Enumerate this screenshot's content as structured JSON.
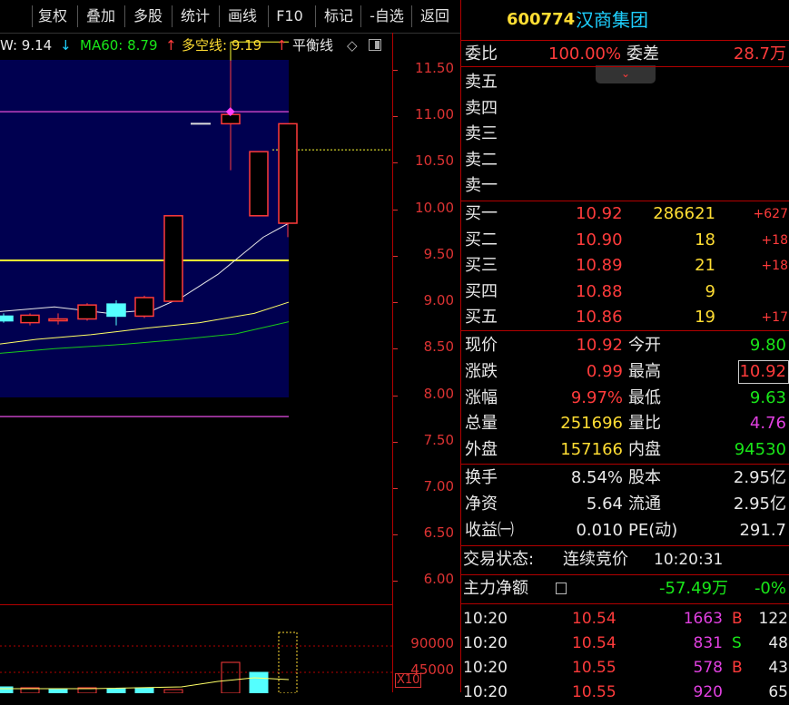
{
  "toolbar": {
    "items": [
      "复权",
      "叠加",
      "多股",
      "统计",
      "画线",
      "F10",
      "标记",
      "-自选",
      "返回"
    ]
  },
  "indicators": {
    "a_label": "W: 9.14",
    "a_arrow": "↓",
    "ma60": "MA60: 8.79",
    "ma60_arrow": "↑",
    "duokong": "多空线: 9.19",
    "duokong_arrow": "↑",
    "pingheng": "平衡线",
    "pingheng_icon": "◇"
  },
  "chart_data": {
    "type": "candlestick",
    "y_axis": {
      "min": 5.75,
      "max": 11.9,
      "ticks": [
        "11.50",
        "11.00",
        "10.50",
        "10.00",
        "9.50",
        "9.00",
        "8.50",
        "8.00",
        "7.50",
        "7.00",
        "6.50",
        "6.00"
      ]
    },
    "volume_axis": {
      "ticks": [
        "90000",
        "45000"
      ],
      "unit": "X10"
    },
    "candles": [
      {
        "o": 8.85,
        "c": 8.8,
        "h": 8.88,
        "l": 8.78
      },
      {
        "o": 8.78,
        "c": 8.86,
        "h": 8.88,
        "l": 8.75
      },
      {
        "o": 8.82,
        "c": 8.82,
        "h": 8.88,
        "l": 8.76
      },
      {
        "o": 8.82,
        "c": 8.97,
        "h": 8.99,
        "l": 8.8
      },
      {
        "o": 8.98,
        "c": 8.85,
        "h": 9.02,
        "l": 8.75
      },
      {
        "o": 8.85,
        "c": 9.05,
        "h": 9.07,
        "l": 8.83
      },
      {
        "o": 9.01,
        "c": 9.93,
        "h": 9.93,
        "l": 9.01
      },
      {
        "o": 10.92,
        "c": 11.02,
        "h": 11.6,
        "l": 10.42
      },
      {
        "o": 9.93,
        "c": 10.62,
        "h": 10.62,
        "l": 9.93
      },
      {
        "o": 9.85,
        "c": 10.92,
        "h": 10.92,
        "l": 9.7
      }
    ],
    "levels": [
      11.05,
      9.45,
      7.77
    ],
    "dashed_level": 10.64
  },
  "panel": {
    "code": "600774",
    "name": "汉商集团",
    "weibi_label": "委比",
    "weibi": "100.00%",
    "weicha_label": "委差",
    "weicha": "28.7万",
    "sell": [
      {
        "label": "卖五",
        "price": "",
        "vol": "",
        "chg": ""
      },
      {
        "label": "卖四",
        "price": "",
        "vol": "",
        "chg": ""
      },
      {
        "label": "卖三",
        "price": "",
        "vol": "",
        "chg": ""
      },
      {
        "label": "卖二",
        "price": "",
        "vol": "",
        "chg": ""
      },
      {
        "label": "卖一",
        "price": "",
        "vol": "",
        "chg": ""
      }
    ],
    "buy": [
      {
        "label": "买一",
        "price": "10.92",
        "vol": "286621",
        "chg": "+627"
      },
      {
        "label": "买二",
        "price": "10.90",
        "vol": "18",
        "chg": "+18"
      },
      {
        "label": "买三",
        "price": "10.89",
        "vol": "21",
        "chg": "+18"
      },
      {
        "label": "买四",
        "price": "10.88",
        "vol": "9",
        "chg": ""
      },
      {
        "label": "买五",
        "price": "10.86",
        "vol": "19",
        "chg": "+17"
      }
    ],
    "stats": [
      {
        "l1": "现价",
        "v1": "10.92",
        "l2": "今开",
        "v2": "9.80"
      },
      {
        "l1": "涨跌",
        "v1": "0.99",
        "l2": "最高",
        "v2": "10.92"
      },
      {
        "l1": "涨幅",
        "v1": "9.97%",
        "l2": "最低",
        "v2": "9.63"
      },
      {
        "l1": "总量",
        "v1": "251696",
        "l2": "量比",
        "v2": "4.76"
      },
      {
        "l1": "外盘",
        "v1": "157166",
        "l2": "内盘",
        "v2": "94530"
      }
    ],
    "fundamentals": [
      {
        "l1": "换手",
        "v1": "8.54%",
        "l2": "股本",
        "v2": "2.95亿"
      },
      {
        "l1": "净资",
        "v1": "5.64",
        "l2": "流通",
        "v2": "2.95亿"
      },
      {
        "l1": "收益㈠",
        "v1": "0.010",
        "l2": "PE(动)",
        "v2": "291.7"
      }
    ],
    "status_label": "交易状态:",
    "status_value": "连续竞价",
    "status_time": "10:20:31",
    "zhuli_label": "主力净额",
    "zhuli_value": "-57.49万",
    "zhuli_pct": "-0%",
    "ticks": [
      {
        "time": "10:20",
        "price": "10.54",
        "vol": "1663",
        "side": "B",
        "n": "122"
      },
      {
        "time": "10:20",
        "price": "10.54",
        "vol": "831",
        "side": "S",
        "n": "48"
      },
      {
        "time": "10:20",
        "price": "10.55",
        "vol": "578",
        "side": "B",
        "n": "43"
      },
      {
        "time": "10:20",
        "price": "10.55",
        "vol": "920",
        "side": "",
        "n": "65"
      }
    ]
  }
}
